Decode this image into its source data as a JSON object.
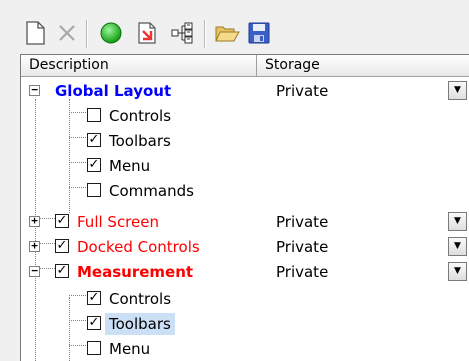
{
  "toolbar": {
    "buttons": [
      {
        "name": "new-document-icon"
      },
      {
        "name": "delete-icon"
      },
      {
        "name": "green-circle-icon"
      },
      {
        "name": "export-icon"
      },
      {
        "name": "tree-structure-icon"
      },
      {
        "name": "open-folder-icon"
      },
      {
        "name": "save-icon"
      }
    ]
  },
  "header": {
    "description": "Description",
    "storage": "Storage"
  },
  "tree": {
    "global_layout": {
      "label": "Global Layout",
      "storage": "Private",
      "color": "#0000ff"
    },
    "gl_controls": {
      "label": "Controls",
      "checked": false
    },
    "gl_toolbars": {
      "label": "Toolbars",
      "checked": true
    },
    "gl_menu": {
      "label": "Menu",
      "checked": true
    },
    "gl_commands": {
      "label": "Commands",
      "checked": false
    },
    "full_screen": {
      "label": "Full Screen",
      "storage": "Private",
      "checked": true,
      "color": "#ff0000"
    },
    "docked_controls": {
      "label": "Docked Controls",
      "storage": "Private",
      "checked": true,
      "color": "#ff0000"
    },
    "measurement": {
      "label": "Measurement",
      "storage": "Private",
      "checked": true,
      "color": "#ff0000"
    },
    "m_controls": {
      "label": "Controls",
      "checked": true
    },
    "m_toolbars": {
      "label": "Toolbars",
      "checked": true,
      "selected": true
    },
    "m_menu": {
      "label": "Menu",
      "checked": false
    }
  }
}
